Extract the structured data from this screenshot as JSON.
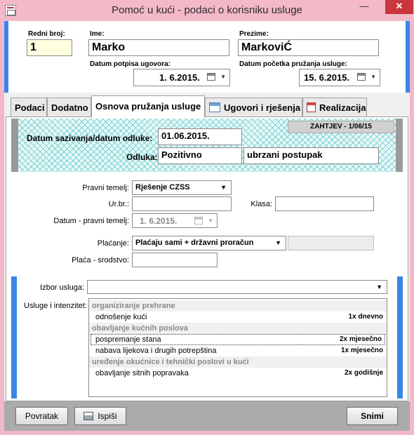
{
  "window": {
    "title": "Pomoć u kući - podaci o korisniku usluge",
    "min_glyph": "—",
    "max_glyph": "☐",
    "close_glyph": "✕"
  },
  "header": {
    "redni_broj_label": "Redni broj:",
    "redni_broj_value": "1",
    "ime_label": "Ime:",
    "ime_value": "Marko",
    "prezime_label": "Prezime:",
    "prezime_value": "MarkoviĆ",
    "datum_potpisa_label": "Datum potpisa ugovora:",
    "datum_potpisa_value": "1.  6.2015.",
    "datum_pocetka_label": "Datum početka pružanja usluge:",
    "datum_pocetka_value": "15.  6.2015."
  },
  "tabs": [
    {
      "label": "Podaci"
    },
    {
      "label": "Dodatno"
    },
    {
      "label": "Osnova pružanja usluge"
    },
    {
      "label": "Ugovori i rješenja"
    },
    {
      "label": "Realizacija"
    }
  ],
  "decision": {
    "zahtjev": "ZAHTJEV - 1/06/15",
    "datum_label": "Datum sazivanja/datum odluke:",
    "datum_value": "01.06.2015.",
    "odluka_label": "Odluka:",
    "odluka_value": "Pozitivno",
    "odluka_note": "ubrzani postupak"
  },
  "form": {
    "pravni_temelj_label": "Pravni temelj:",
    "pravni_temelj_value": "Rješenje CZSS",
    "urbr_label": "Ur.br.:",
    "urbr_value": "",
    "klasa_label": "Klasa:",
    "klasa_value": "",
    "datum_pravni_label": "Datum - pravni temelj:",
    "datum_pravni_value": "1.  6.2015.",
    "placanje_label": "Plaćanje:",
    "placanje_value": "Plaćaju sami + državni proračun",
    "placa_srodstvo_label": "Plaća - srodstvo:",
    "placa_srodstvo_value": ""
  },
  "services": {
    "izbor_label": "Izbor usluga:",
    "izbor_value": "",
    "list_label": "Usluge i intenzitet:",
    "rows": [
      {
        "type": "cat",
        "label": "organiziranje prehrane",
        "freq": ""
      },
      {
        "type": "item",
        "label": "odnošenje kući",
        "freq": "1x dnevno"
      },
      {
        "type": "cat",
        "label": "obavljanje kućnih poslova",
        "freq": ""
      },
      {
        "type": "item sel",
        "label": "pospremanje stana",
        "freq": "2x mjesečno"
      },
      {
        "type": "item",
        "label": "nabava lijekova i drugih potrepština",
        "freq": "1x mjesečno"
      },
      {
        "type": "cat",
        "label": "uređenje okućnice i tehnički poslovi u kući",
        "freq": ""
      },
      {
        "type": "item",
        "label": "obavljanje sitnih popravaka",
        "freq": "2x godišnje"
      }
    ]
  },
  "footer": {
    "povratak": "Povratak",
    "ispisi": "Ispiši",
    "snimi": "Snimi"
  },
  "colors": {
    "accent": "#3a86e8",
    "window_frame": "#f3b9c9",
    "close_button": "#c7373b"
  }
}
